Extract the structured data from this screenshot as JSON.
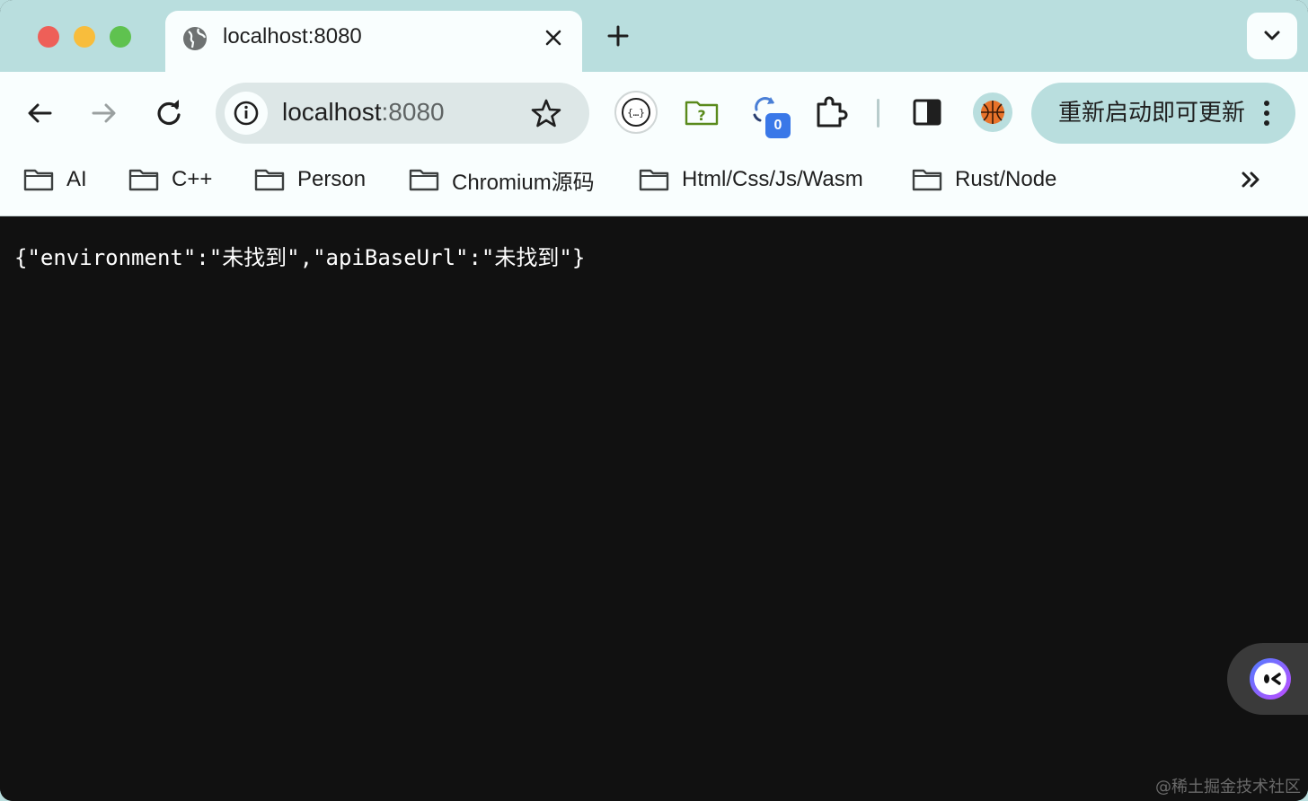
{
  "tab": {
    "title": "localhost:8080"
  },
  "omnibox": {
    "host": "localhost",
    "port": ":8080"
  },
  "toolbar": {
    "extension_badge": "0",
    "update_button": "重新启动即可更新"
  },
  "bookmarks": [
    {
      "label": "AI"
    },
    {
      "label": "C++"
    },
    {
      "label": "Person"
    },
    {
      "label": "Chromium源码"
    },
    {
      "label": "Html/Css/Js/Wasm"
    },
    {
      "label": "Rust/Node"
    }
  ],
  "page": {
    "body_text": "{\"environment\":\"未找到\",\"apiBaseUrl\":\"未找到\"}"
  },
  "watermark": "@稀土掘金技术社区",
  "icons": {
    "tab": [
      "globe-icon",
      "close-icon",
      "plus-icon",
      "chevron-down-icon"
    ],
    "toolbar": [
      "back-arrow-icon",
      "forward-arrow-icon",
      "reload-icon",
      "info-icon",
      "star-icon",
      "json-viewer-icon",
      "folder-question-icon",
      "refresh-extension-icon",
      "puzzle-icon",
      "side-panel-icon",
      "basketball-icon",
      "kebab-menu-icon"
    ],
    "bookmarks": [
      "folder-icon",
      "double-chevron-right-icon"
    ]
  },
  "colors": {
    "frame": "#b9dede",
    "toolbar": "#f9fefe",
    "omnibox": "#dde7e7",
    "page_bg": "#111111",
    "badge": "#3a78e8"
  }
}
